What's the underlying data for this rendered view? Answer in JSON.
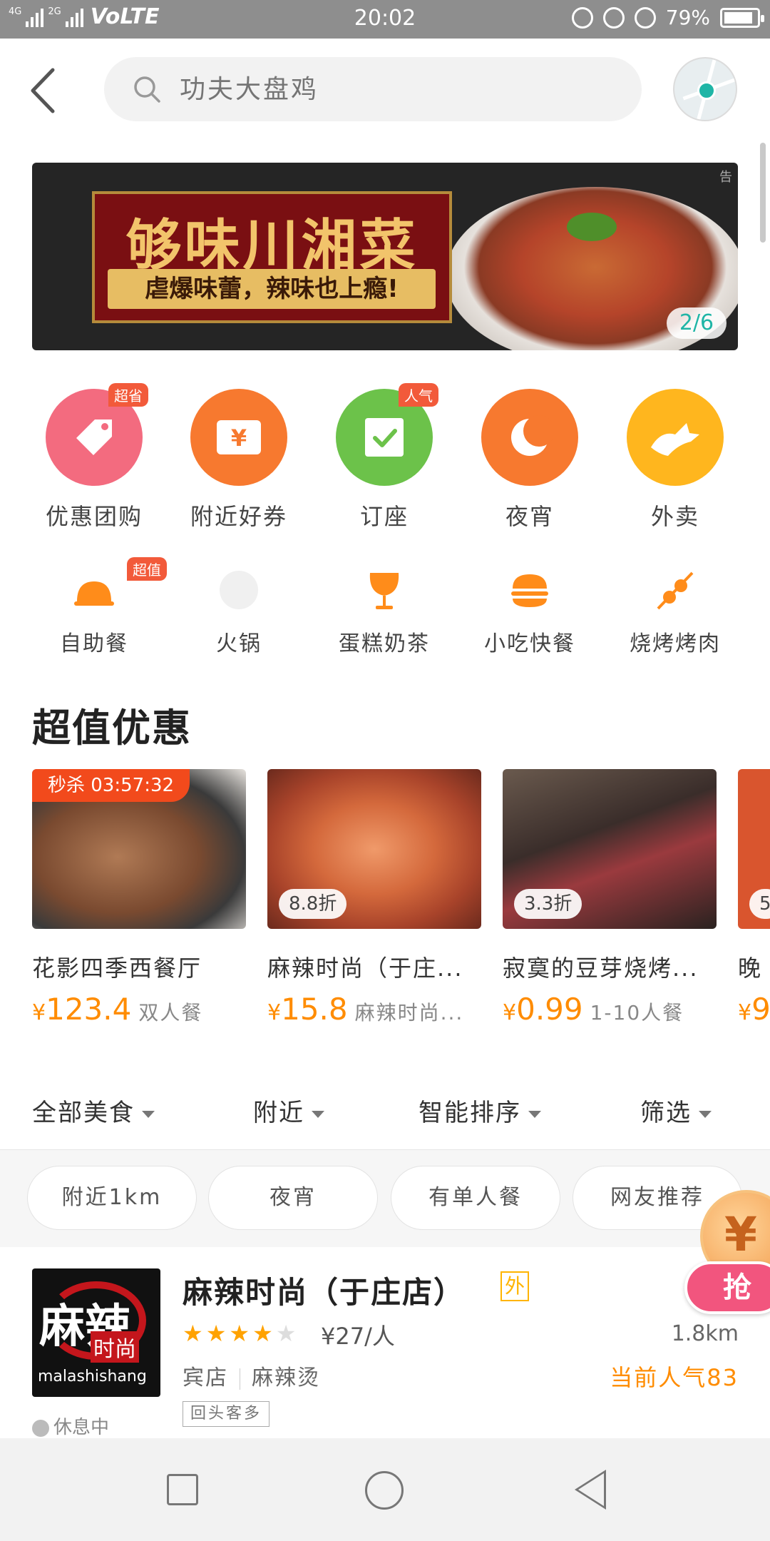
{
  "status_bar": {
    "network_1": "4G",
    "network_2": "2G",
    "volte": "VoLTE",
    "time": "20:02",
    "battery": "79%",
    "icons": [
      "mute-icon",
      "lock-rotation-icon",
      "alarm-icon",
      "battery-icon"
    ]
  },
  "header": {
    "search_placeholder": "功夫大盘鸡",
    "icons": [
      "back-icon",
      "search-icon",
      "map-location-icon"
    ]
  },
  "banner": {
    "title": "够味川湘菜",
    "subtitle": "虐爆味蕾，辣味也上瘾!",
    "pager": "2/6",
    "tag": "告"
  },
  "categories": [
    {
      "label": "优惠团购",
      "badge": "超省",
      "color": "#f36b7f",
      "icon": "tag-icon"
    },
    {
      "label": "附近好券",
      "badge": "",
      "color": "#f7792f",
      "icon": "coupon-icon"
    },
    {
      "label": "订座",
      "badge": "人气",
      "color": "#6cc24a",
      "icon": "reserve-icon"
    },
    {
      "label": "夜宵",
      "badge": "",
      "color": "#f7792f",
      "icon": "moon-icon"
    },
    {
      "label": "外卖",
      "badge": "",
      "color": "#ffb61e",
      "icon": "delivery-icon"
    }
  ],
  "subcategories": [
    {
      "label": "自助餐",
      "badge": "超值",
      "icon": "buffet-icon"
    },
    {
      "label": "火锅",
      "badge": "",
      "icon": "hotpot-icon"
    },
    {
      "label": "蛋糕奶茶",
      "badge": "",
      "icon": "drink-icon"
    },
    {
      "label": "小吃快餐",
      "badge": "",
      "icon": "burger-icon"
    },
    {
      "label": "烧烤烤肉",
      "badge": "",
      "icon": "skewer-icon"
    }
  ],
  "deals_section": {
    "title": "超值优惠",
    "items": [
      {
        "flash": "秒杀 03:57:32",
        "discount": "",
        "name": "花影四季西餐厅",
        "price": "123.4",
        "note": "双人餐",
        "bg": "#6b4a36"
      },
      {
        "flash": "",
        "discount": "8.8折",
        "name": "麻辣时尚（于庄...",
        "price": "15.8",
        "note": "麻辣时尚...",
        "bg": "#c4653a"
      },
      {
        "flash": "",
        "discount": "3.3折",
        "name": "寂寞的豆芽烧烤...",
        "price": "0.99",
        "note": "1-10人餐",
        "bg": "#3a2d2a"
      },
      {
        "flash": "",
        "discount": "5",
        "name": "晚",
        "price": "9",
        "note": "",
        "bg": "#d9552e"
      }
    ]
  },
  "filters": {
    "items": [
      "全部美食",
      "附近",
      "智能排序",
      "筛选"
    ],
    "chips": [
      "附近1km",
      "夜宵",
      "有单人餐",
      "网友推荐"
    ]
  },
  "shop": {
    "logo_big": "麻辣",
    "logo_mid": "时尚",
    "logo_en": "malashishang",
    "name": "麻辣时尚（于庄店）",
    "tag": "外",
    "rating_stars": 4,
    "price_per": "¥27/人",
    "distance": "1.8km",
    "category_1": "宾店",
    "category_2": "麻辣烫",
    "popularity": "当前人气83",
    "status": "休息中",
    "badge": "回头客多"
  },
  "promo": {
    "coin": "¥",
    "button": "抢"
  }
}
